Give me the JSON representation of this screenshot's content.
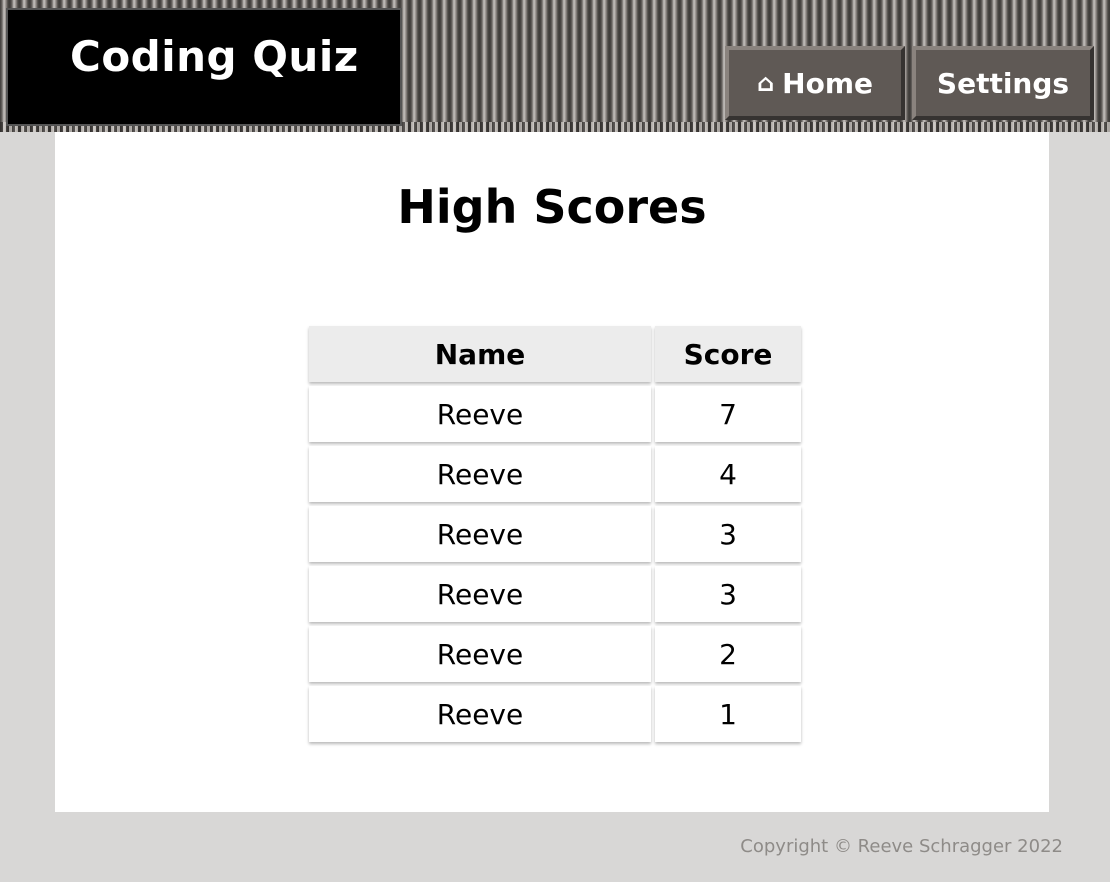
{
  "header": {
    "brand_title": "Coding Quiz",
    "nav": {
      "home_icon": "house-icon",
      "home_glyph": "⌂",
      "home_label": "Home",
      "settings_label": "Settings"
    }
  },
  "main": {
    "title": "High Scores",
    "table": {
      "columns": [
        "Name",
        "Score"
      ],
      "rows": [
        {
          "name": "Reeve",
          "score": "7"
        },
        {
          "name": "Reeve",
          "score": "4"
        },
        {
          "name": "Reeve",
          "score": "3"
        },
        {
          "name": "Reeve",
          "score": "3"
        },
        {
          "name": "Reeve",
          "score": "2"
        },
        {
          "name": "Reeve",
          "score": "1"
        }
      ]
    }
  },
  "footer": {
    "copyright": "Copyright © Reeve Schragger 2022"
  }
}
